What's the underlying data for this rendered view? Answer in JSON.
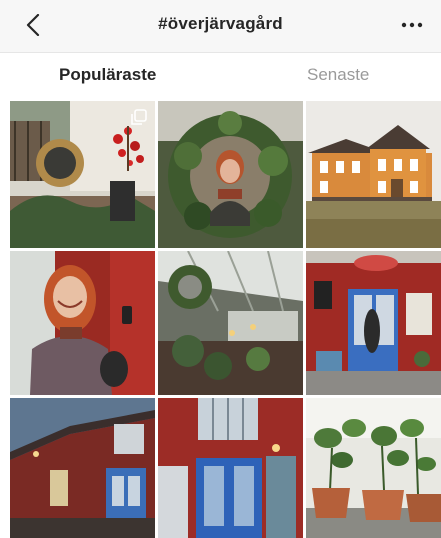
{
  "header": {
    "title": "#överjärvagård",
    "back_icon": "chevron-left-icon",
    "more_icon": "more-horizontal-icon"
  },
  "tabs": [
    {
      "label": "Populäraste",
      "selected": true
    },
    {
      "label": "Senaste",
      "selected": false
    }
  ],
  "colors": {
    "header_bg": "#f7f7f7",
    "active_tab": "#262626",
    "inactive_tab": "#9a9a9a"
  },
  "grid": {
    "columns": 3,
    "posts": [
      {
        "subject": "wreath with red berries",
        "multiple": true
      },
      {
        "subject": "woman in greenery wreath",
        "multiple": false
      },
      {
        "subject": "yellow wooden house",
        "multiple": false
      },
      {
        "subject": "red-haired woman at red door",
        "multiple": false
      },
      {
        "subject": "greenhouse interior with wreath",
        "multiple": false
      },
      {
        "subject": "shop entrance blue door",
        "multiple": false
      },
      {
        "subject": "red barn at dusk",
        "multiple": false
      },
      {
        "subject": "blue doors red wall",
        "multiple": false
      },
      {
        "subject": "potted seedlings",
        "multiple": false
      }
    ]
  }
}
